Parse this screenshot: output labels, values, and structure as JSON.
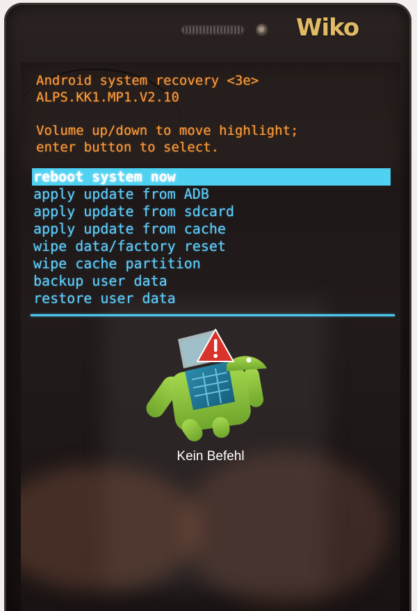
{
  "device": {
    "brand_logo": "Wiko"
  },
  "recovery": {
    "header": {
      "title": "Android system recovery <3e>",
      "version": "ALPS.KK1.MP1.V2.10"
    },
    "instructions": {
      "line1": "Volume up/down to move highlight;",
      "line2": "enter button to select."
    },
    "menu": {
      "selected_index": 0,
      "items": [
        {
          "label": "reboot system now"
        },
        {
          "label": "apply update from ADB"
        },
        {
          "label": "apply update from sdcard"
        },
        {
          "label": "apply update from cache"
        },
        {
          "label": "wipe data/factory reset"
        },
        {
          "label": "wipe cache partition"
        },
        {
          "label": "backup user data"
        },
        {
          "label": "restore user data"
        }
      ]
    },
    "status": {
      "icon": "android-error-icon",
      "caption": "Kein Befehl"
    }
  },
  "colors": {
    "header_text": "#ff9d3a",
    "menu_text": "#5ed1ff",
    "highlight": "#4fd2f2",
    "divider": "#4cc8ef",
    "android_green": "#8cc63f",
    "warning_red": "#d9342b"
  }
}
